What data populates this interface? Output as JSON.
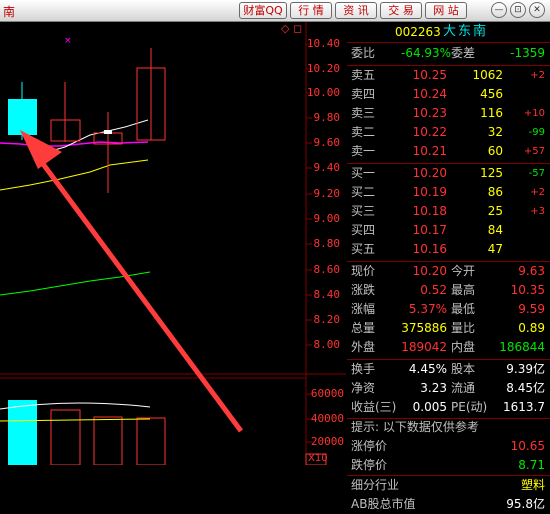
{
  "titlebar": {
    "stock_short": "南",
    "buttons": [
      "财富QQ",
      "行 情",
      "资 讯",
      "交 易",
      "网 站"
    ],
    "win_icons": [
      "—",
      "⊡",
      "✕"
    ]
  },
  "chart": {
    "price_axis": [
      "10.40",
      "10.20",
      "10.00",
      "9.80",
      "9.60",
      "9.40",
      "9.20",
      "9.00",
      "8.80",
      "8.60",
      "8.40",
      "8.20",
      "8.00"
    ],
    "volume_axis": [
      "60000",
      "40000",
      "20000"
    ],
    "volume_unit": "X10",
    "marker_icons": [
      "◇",
      "◻"
    ],
    "colors": {
      "up": "#ff3232",
      "down": "#00ffff",
      "ma5": "#ffffff",
      "ma10": "#ffff00",
      "ma20": "#ff00ff",
      "ma60": "#00ff00",
      "arrow": "#ff3c3c"
    }
  },
  "quote": {
    "code": "002263",
    "name": "大东南",
    "weibi_label": "委比",
    "weibi_value": "-64.93%",
    "weicha_label": "委差",
    "weicha_value": "-1359",
    "sells": [
      {
        "label": "卖五",
        "price": "10.25",
        "vol": "1062",
        "chg": "+2"
      },
      {
        "label": "卖四",
        "price": "10.24",
        "vol": "456",
        "chg": ""
      },
      {
        "label": "卖三",
        "price": "10.23",
        "vol": "116",
        "chg": "+10"
      },
      {
        "label": "卖二",
        "price": "10.22",
        "vol": "32",
        "chg": "-99"
      },
      {
        "label": "卖一",
        "price": "10.21",
        "vol": "60",
        "chg": "+57"
      }
    ],
    "buys": [
      {
        "label": "买一",
        "price": "10.20",
        "vol": "125",
        "chg": "-57"
      },
      {
        "label": "买二",
        "price": "10.19",
        "vol": "86",
        "chg": "+2"
      },
      {
        "label": "买三",
        "price": "10.18",
        "vol": "25",
        "chg": "+3"
      },
      {
        "label": "买四",
        "price": "10.17",
        "vol": "84",
        "chg": ""
      },
      {
        "label": "买五",
        "price": "10.16",
        "vol": "47",
        "chg": ""
      }
    ],
    "stats": [
      {
        "l1": "现价",
        "v1": "10.20",
        "c1": "red",
        "l2": "今开",
        "v2": "9.63",
        "c2": "red"
      },
      {
        "l1": "涨跌",
        "v1": "0.52",
        "c1": "red",
        "l2": "最高",
        "v2": "10.35",
        "c2": "red"
      },
      {
        "l1": "涨幅",
        "v1": "5.37%",
        "c1": "red",
        "l2": "最低",
        "v2": "9.59",
        "c2": "red"
      },
      {
        "l1": "总量",
        "v1": "375886",
        "c1": "yel",
        "l2": "量比",
        "v2": "0.89",
        "c2": "yel"
      },
      {
        "l1": "外盘",
        "v1": "189042",
        "c1": "red",
        "l2": "内盘",
        "v2": "186844",
        "c2": "grn"
      }
    ],
    "fund": [
      {
        "l1": "换手",
        "v1": "4.45%",
        "l2": "股本",
        "v2": "9.39亿"
      },
      {
        "l1": "净资",
        "v1": "3.23",
        "l2": "流通",
        "v2": "8.45亿"
      },
      {
        "l1": "收益(三)",
        "v1": "0.005",
        "l2": "PE(动)",
        "v2": "1613.7"
      }
    ],
    "tip": "提示: 以下数据仅供参考",
    "limit_up_label": "涨停价",
    "limit_up": "10.65",
    "limit_down_label": "跌停价",
    "limit_down": "8.71",
    "industry_label": "细分行业",
    "industry": "塑料",
    "mcap_label": "AB股总市值",
    "mcap": "95.8亿"
  }
}
